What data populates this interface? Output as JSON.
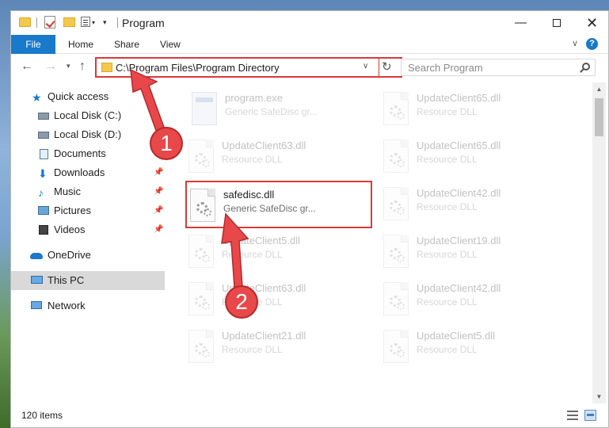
{
  "window": {
    "title": "Program"
  },
  "ribbon": {
    "tabs": [
      "File",
      "Home",
      "Share",
      "View"
    ]
  },
  "nav": {
    "address": "C:\\Program Files\\Program Directory",
    "search_placeholder": "Search Program"
  },
  "sidebar": {
    "items": [
      {
        "label": "Quick access",
        "icon": "star-icon",
        "pinned": false
      },
      {
        "label": "Local Disk (C:)",
        "icon": "disk-icon",
        "pinned": false
      },
      {
        "label": "Local Disk (D:)",
        "icon": "disk-icon",
        "pinned": false
      },
      {
        "label": "Documents",
        "icon": "documents-icon",
        "pinned": true
      },
      {
        "label": "Downloads",
        "icon": "download-icon",
        "pinned": true
      },
      {
        "label": "Music",
        "icon": "music-icon",
        "pinned": true
      },
      {
        "label": "Pictures",
        "icon": "pictures-icon",
        "pinned": true
      },
      {
        "label": "Videos",
        "icon": "videos-icon",
        "pinned": true
      },
      {
        "label": "OneDrive",
        "icon": "cloud-icon",
        "pinned": false
      },
      {
        "label": "This PC",
        "icon": "pc-icon",
        "pinned": false,
        "active": true
      },
      {
        "label": "Network",
        "icon": "network-icon",
        "pinned": false
      }
    ]
  },
  "files": [
    {
      "name": "program.exe",
      "subtitle": "Generic SafeDisc gr...",
      "type": "exe",
      "faded": true
    },
    {
      "name": "UpdateClient65.dll",
      "subtitle": "Resource DLL",
      "type": "dll",
      "faded": true
    },
    {
      "name": "UpdateClient63.dll",
      "subtitle": "Resource DLL",
      "type": "dll",
      "faded": true
    },
    {
      "name": "UpdateClient65.dll",
      "subtitle": "Resource DLL",
      "type": "dll",
      "faded": true
    },
    {
      "name": "safedisc.dll",
      "subtitle": "Generic SafeDisc gr...",
      "type": "dll",
      "faded": false,
      "selected": true
    },
    {
      "name": "UpdateClient42.dll",
      "subtitle": "Resource DLL",
      "type": "dll",
      "faded": true
    },
    {
      "name": "UpdateClient5.dll",
      "subtitle": "Resource DLL",
      "type": "dll",
      "faded": true
    },
    {
      "name": "UpdateClient19.dll",
      "subtitle": "Resource DLL",
      "type": "dll",
      "faded": true
    },
    {
      "name": "UpdateClient63.dll",
      "subtitle": "Resource DLL",
      "type": "dll",
      "faded": true
    },
    {
      "name": "UpdateClient42.dll",
      "subtitle": "Resource DLL",
      "type": "dll",
      "faded": true
    },
    {
      "name": "UpdateClient21.dll",
      "subtitle": "Resource DLL",
      "type": "dll",
      "faded": true
    },
    {
      "name": "UpdateClient5.dll",
      "subtitle": "Resource DLL",
      "type": "dll",
      "faded": true
    }
  ],
  "status": {
    "item_count": "120 items"
  },
  "annotations": {
    "callout_1": "1",
    "callout_2": "2",
    "color": "#e8484a"
  }
}
